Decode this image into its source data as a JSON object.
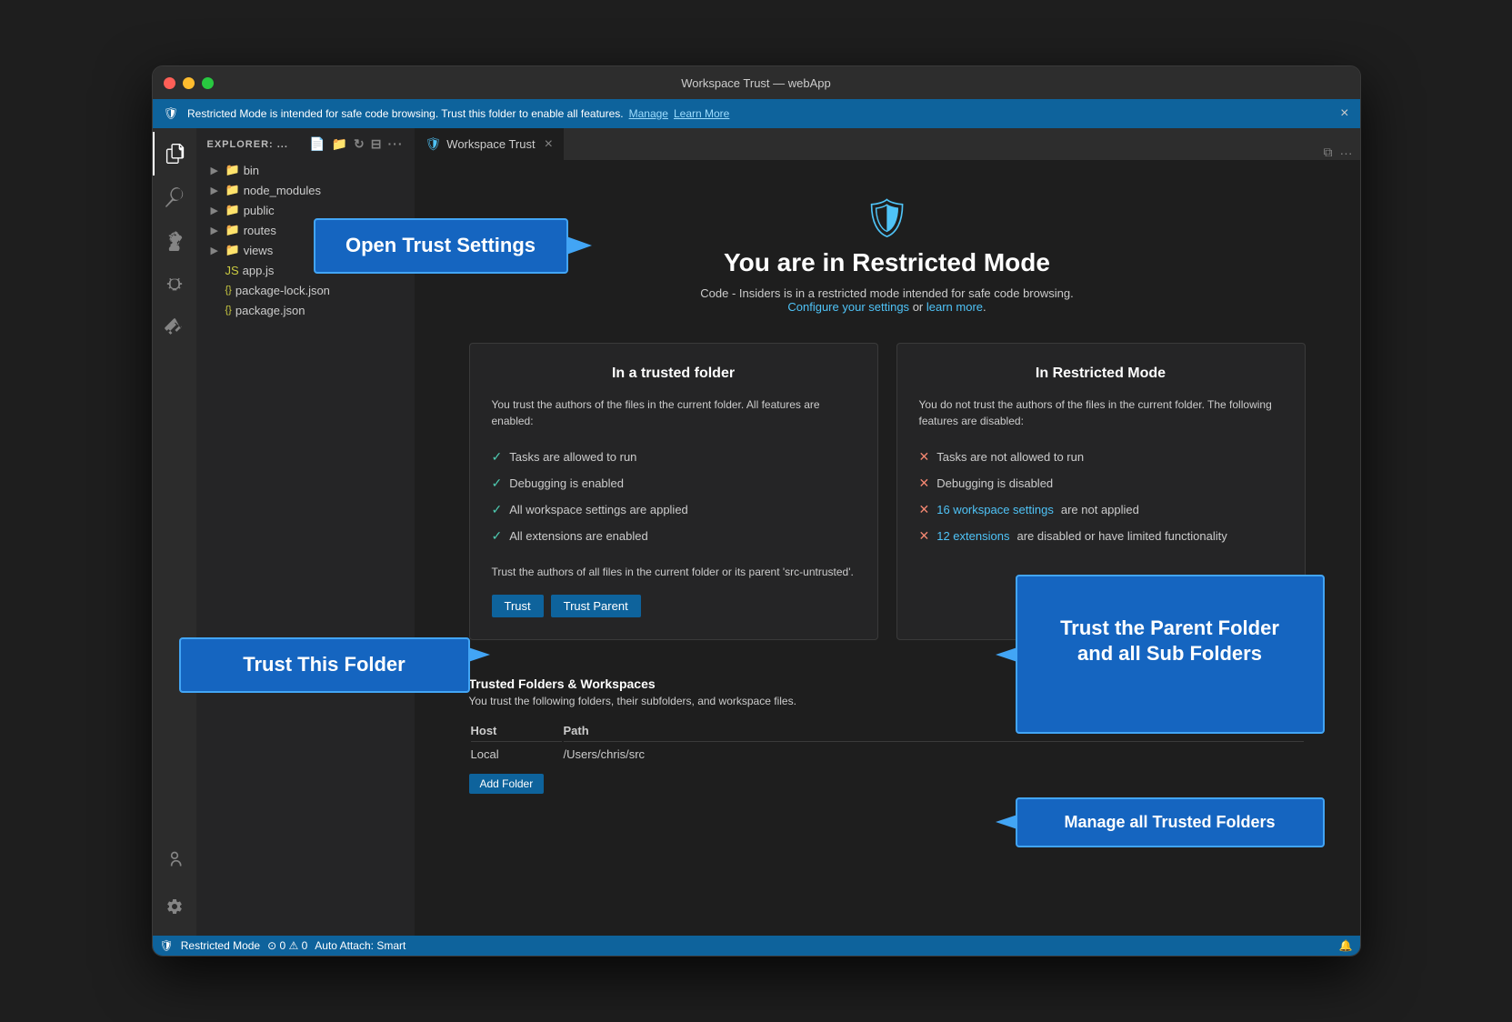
{
  "window": {
    "title": "Workspace Trust — webApp",
    "traffic_lights": [
      "red",
      "yellow",
      "green"
    ]
  },
  "notification": {
    "message": "Restricted Mode is intended for safe code browsing. Trust this folder to enable all features.",
    "manage_label": "Manage",
    "learn_more_label": "Learn More"
  },
  "activity_bar": {
    "items": [
      {
        "name": "explorer",
        "icon": "⎘"
      },
      {
        "name": "search",
        "icon": "🔍"
      },
      {
        "name": "source-control",
        "icon": "⑂"
      },
      {
        "name": "debug",
        "icon": "🐞"
      },
      {
        "name": "extensions",
        "icon": "⊞"
      }
    ],
    "bottom_items": [
      {
        "name": "account",
        "icon": "👤"
      },
      {
        "name": "settings",
        "icon": "⚙"
      }
    ]
  },
  "sidebar": {
    "header": "EXPLORER: ...",
    "tree": [
      {
        "label": "bin",
        "type": "folder"
      },
      {
        "label": "node_modules",
        "type": "folder"
      },
      {
        "label": "public",
        "type": "folder"
      },
      {
        "label": "routes",
        "type": "folder"
      },
      {
        "label": "views",
        "type": "folder"
      },
      {
        "label": "app.js",
        "type": "js"
      },
      {
        "label": "package-lock.json",
        "type": "json"
      },
      {
        "label": "package.json",
        "type": "json"
      }
    ]
  },
  "tab": {
    "label": "Workspace Trust",
    "close": "×"
  },
  "content": {
    "header_icon": "🛡",
    "title": "You are in Restricted Mode",
    "subtitle": "Code - Insiders is in a restricted mode intended for safe code browsing.",
    "configure_label": "Configure your settings",
    "or_text": " or ",
    "learn_more_label": "learn more",
    "trusted_card": {
      "title": "In a trusted folder",
      "description": "You trust the authors of the files in the current folder. All features are enabled:",
      "features": [
        "Tasks are allowed to run",
        "Debugging is enabled",
        "All workspace settings are applied",
        "All extensions are enabled"
      ],
      "note": "Trust the authors of all files in the current folder or its parent 'src-untrusted'.",
      "trust_label": "Trust",
      "trust_parent_label": "Trust Parent"
    },
    "restricted_card": {
      "title": "In Restricted Mode",
      "description": "You do not trust the authors of the files in the current folder. The following features are disabled:",
      "features": [
        {
          "text": "Tasks are not allowed to run",
          "link": null
        },
        {
          "text": "Debugging is disabled",
          "link": null
        },
        {
          "text": "16 workspace settings",
          "suffix": " are not applied",
          "link": "16 workspace settings"
        },
        {
          "text": "12 extensions",
          "suffix": " are disabled or have limited functionality",
          "link": "12 extensions"
        }
      ]
    },
    "trusted_folders": {
      "title": "Trusted Folders & Workspaces",
      "description": "You trust the following folders, their subfolders, and workspace files.",
      "columns": [
        "Host",
        "Path"
      ],
      "rows": [
        {
          "host": "Local",
          "path": "/Users/chris/src"
        }
      ],
      "add_folder_label": "Add Folder"
    }
  },
  "callouts": {
    "open_trust_settings": "Open Trust Settings",
    "trust_this_folder": "Trust This Folder",
    "trust_parent_folder": "Trust the Parent Folder\nand all Sub Folders",
    "manage_trusted_folders": "Manage all Trusted Folders"
  },
  "status_bar": {
    "mode": "Restricted Mode",
    "shield": "🛡",
    "errors": "⊙ 0",
    "warnings": "⚠ 0",
    "auto_attach": "Auto Attach: Smart",
    "bell": "🔔"
  }
}
